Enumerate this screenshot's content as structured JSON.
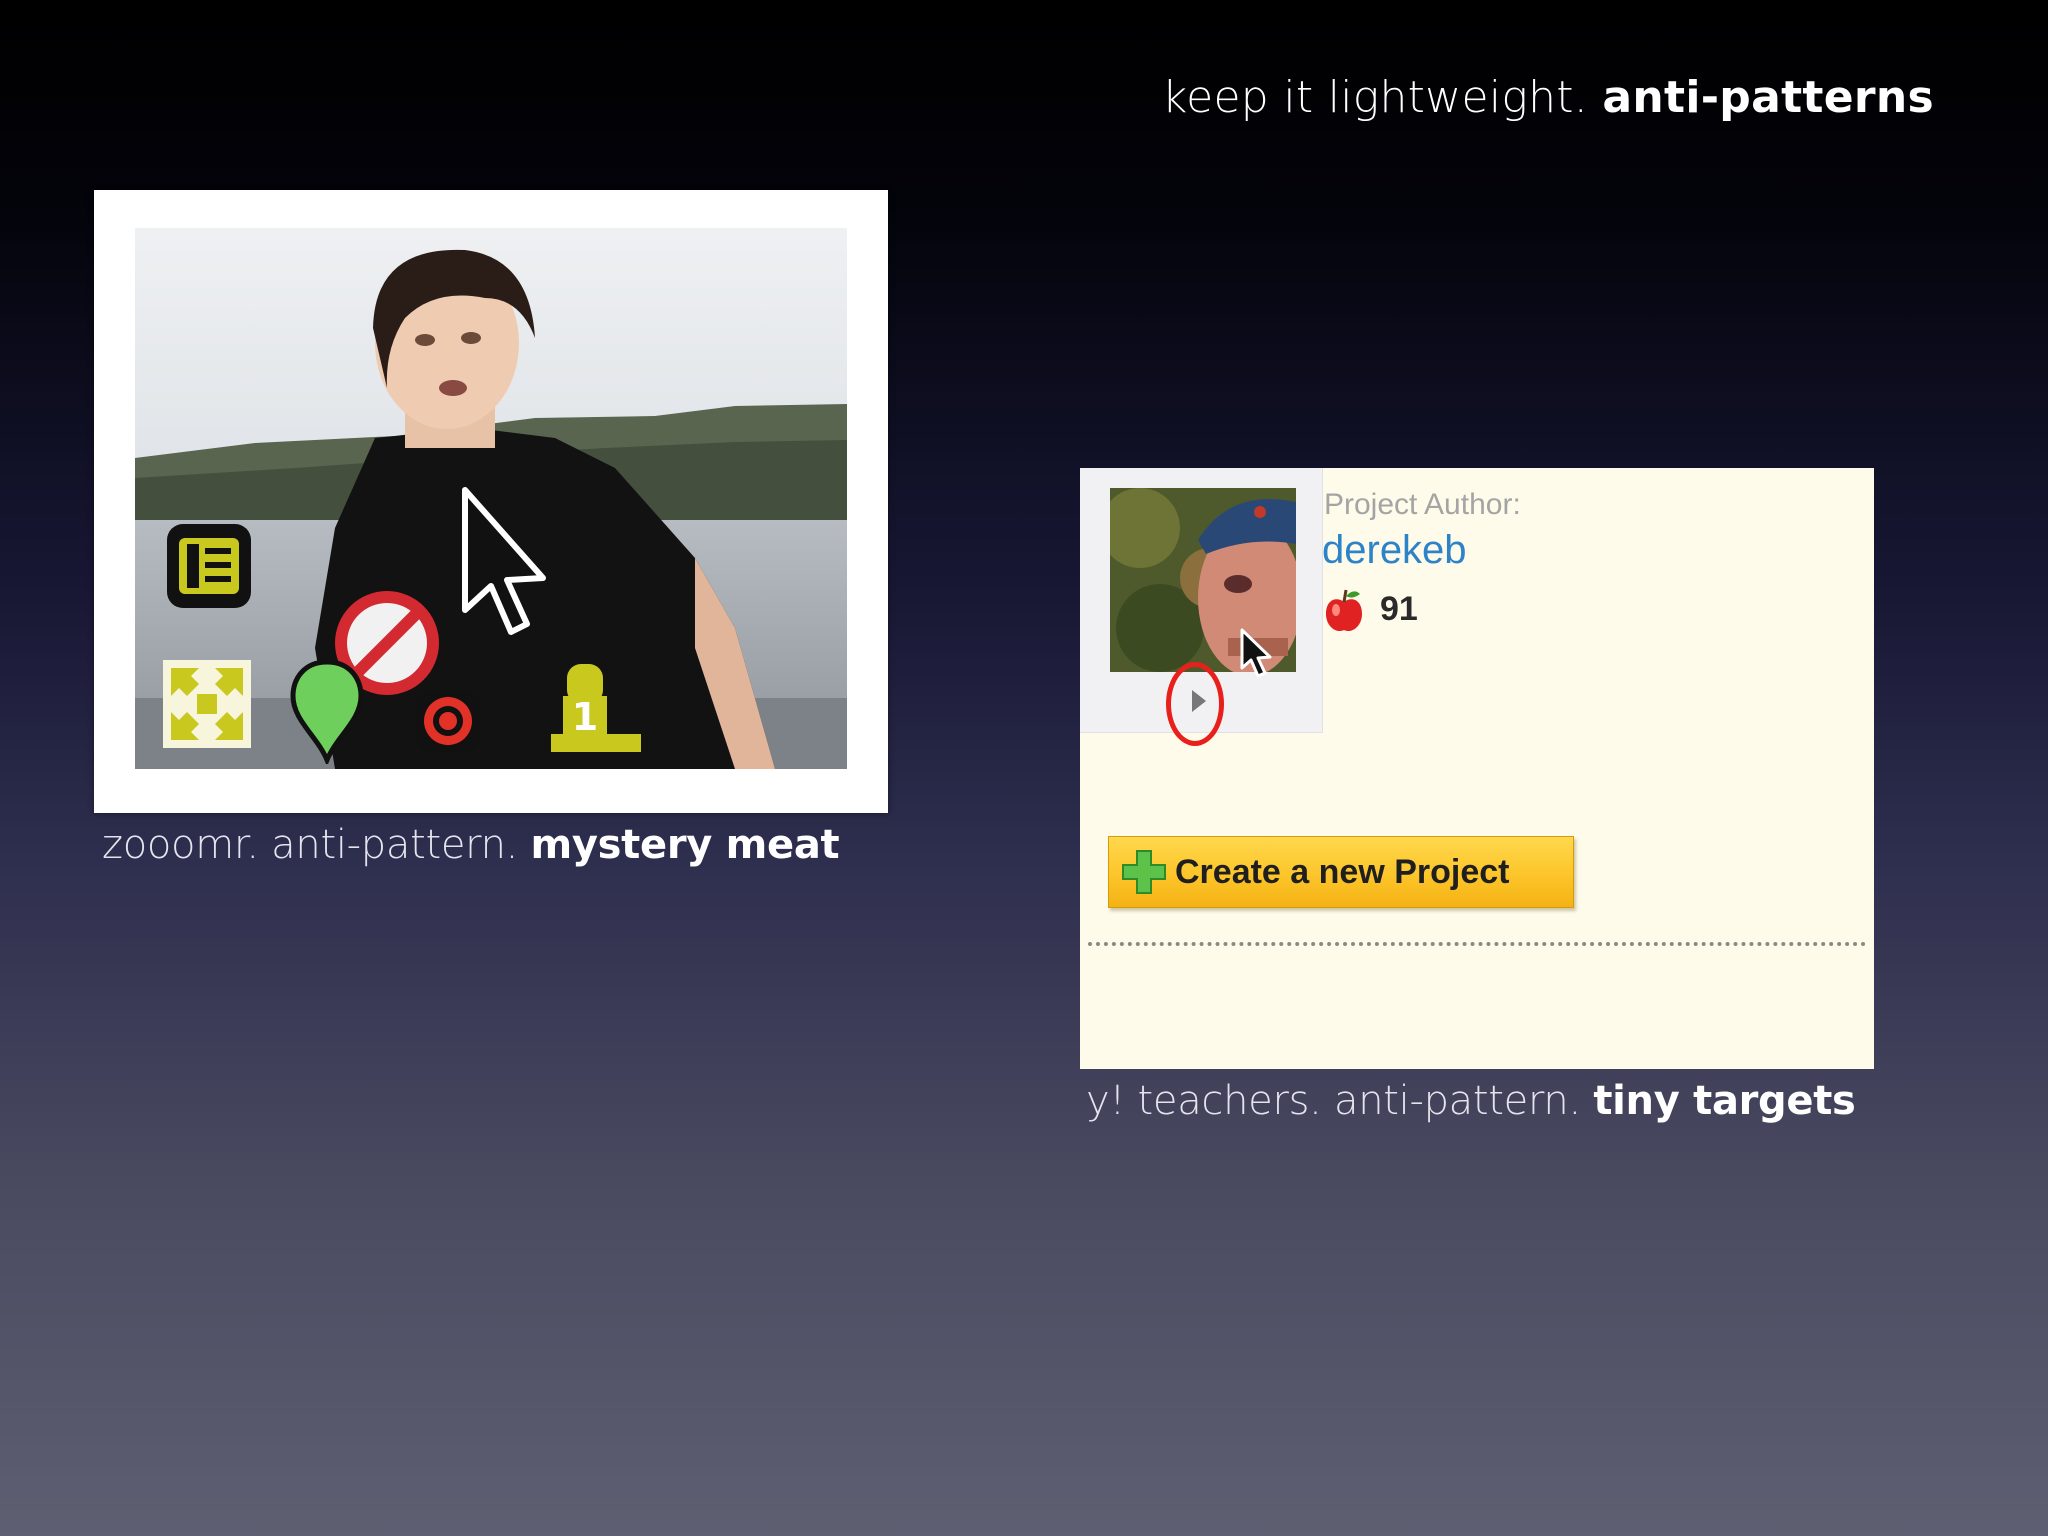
{
  "slide": {
    "title_light": "keep it lightweight.",
    "title_bold": "anti-patterns"
  },
  "zooomr": {
    "caption_light": "zooomr. anti-pattern.",
    "caption_bold": "mystery meat",
    "overlay_icons": [
      "notes-icon",
      "fullscreen-icon",
      "geotag-pin-icon",
      "target-icon",
      "rank-one-icon"
    ],
    "icon_colors": {
      "accent": "#c8c81e",
      "pin": "#6fcf5c",
      "target": "#e23228"
    }
  },
  "yteachers": {
    "caption_light": "y! teachers. anti-pattern.",
    "caption_bold": "tiny targets",
    "author_label": "Project Author:",
    "author_name": "derekeb",
    "apple_score": "91",
    "create_button_label": "Create a new Project",
    "colors": {
      "link": "#2d83c8",
      "button": "#fcc52a",
      "highlight": "#e8201c",
      "panel": "#fffbea"
    }
  }
}
